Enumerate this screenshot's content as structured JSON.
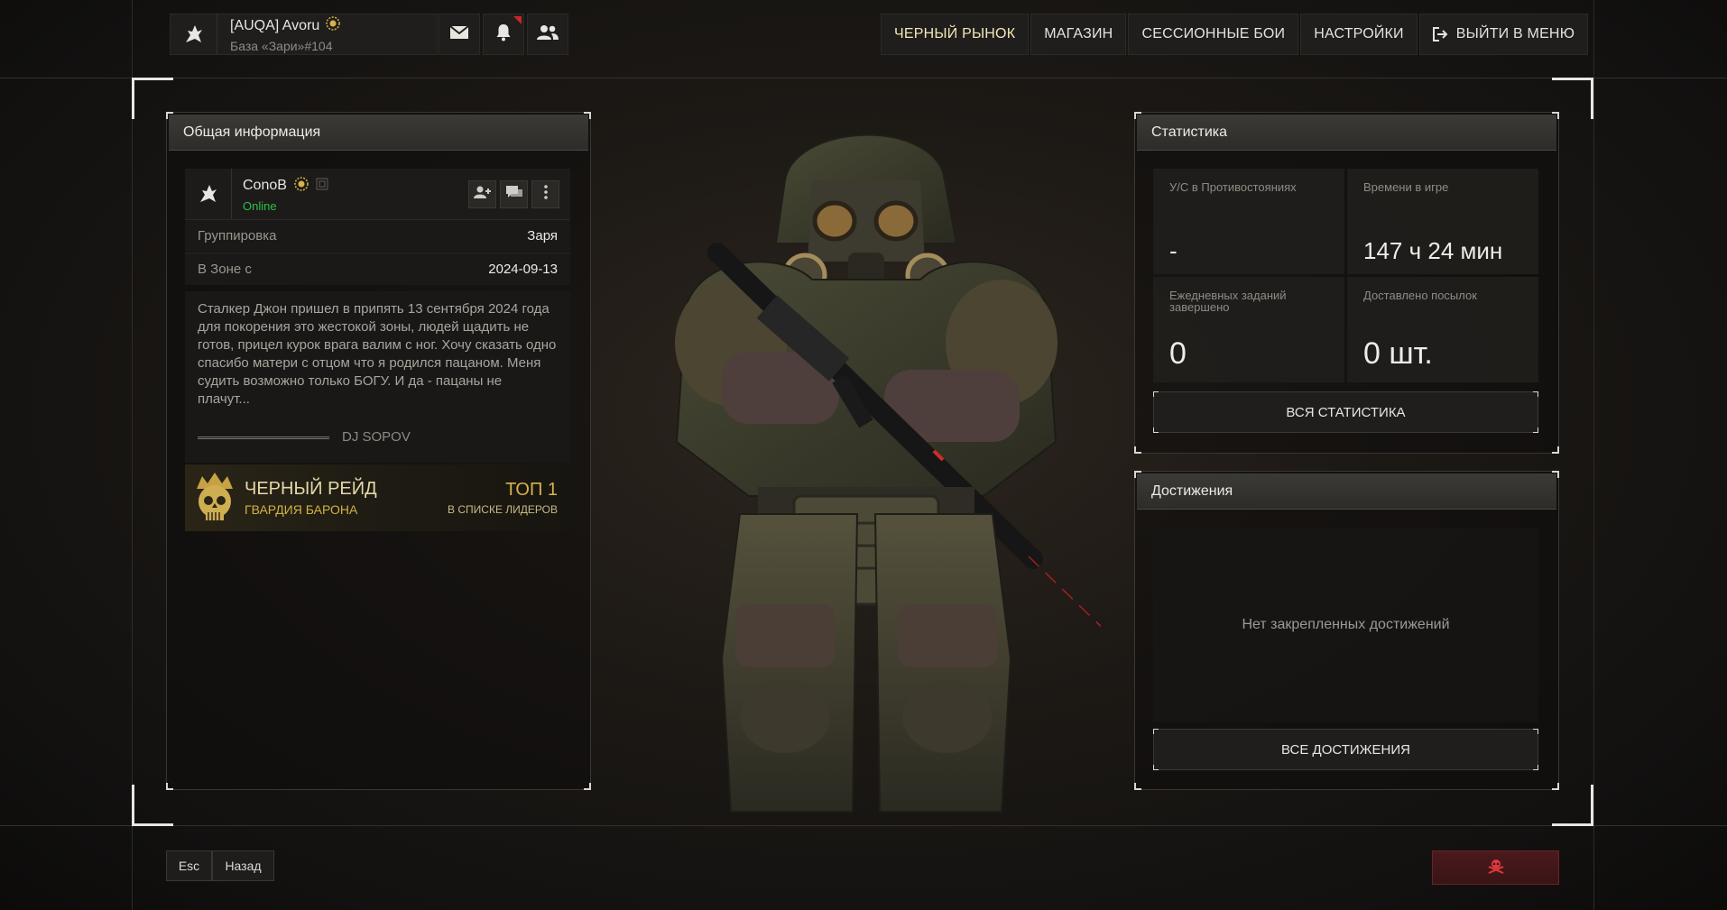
{
  "header": {
    "player_name": "[AUQA] Avoru",
    "base_label": "База «Зари»#104",
    "mail_icon": "mail-icon",
    "notifications_icon": "bell-icon",
    "friends_icon": "friends-icon"
  },
  "topnav": {
    "items": [
      {
        "label": "ЧЕРНЫЙ РЫНОК",
        "active": true
      },
      {
        "label": "МАГАЗИН",
        "active": false
      },
      {
        "label": "СЕССИОННЫЕ БОИ",
        "active": false
      },
      {
        "label": "НАСТРОЙКИ",
        "active": false
      },
      {
        "label": "ВЫЙТИ В МЕНЮ",
        "active": false,
        "icon": "exit-icon"
      }
    ]
  },
  "general_info": {
    "title": "Общая информация",
    "player": {
      "name": "ConoB",
      "status": "Online",
      "actions": [
        "add-friend-icon",
        "chat-icon",
        "more-icon"
      ]
    },
    "rows": [
      {
        "key": "Группировка",
        "value": "Заря"
      },
      {
        "key": "В Зоне с",
        "value": "2024-09-13"
      }
    ],
    "bio": "Сталкер Джон пришел в припять 13 сентября 2024 года для покорения это жестокой зоны, людей щадить не готов, прицел курок врага валим с ног. Хочу сказать одно спасибо матери с отцом что я родился пацаном. Меня судить возможно только БОГУ. И да - пацаны не плачут...",
    "signature": "DJ SOPOV",
    "raid": {
      "title": "ЧЕРНЫЙ РЕЙД",
      "subtitle": "ГВАРДИЯ БАРОНА",
      "rank": "ТОП 1",
      "rank_sub": "В СПИСКЕ ЛИДЕРОВ"
    }
  },
  "statistics": {
    "title": "Статистика",
    "cells": [
      {
        "label": "У/С в Противостояниях",
        "value": "-"
      },
      {
        "label": "Времени в игре",
        "value": "147 ч 24 мин"
      },
      {
        "label": "Ежедневных заданий завершено",
        "value": "0"
      },
      {
        "label": "Доставлено посылок",
        "value": "0 шт."
      }
    ],
    "button": "ВСЯ СТАТИСТИКА"
  },
  "achievements": {
    "title": "Достижения",
    "empty_text": "Нет закрепленных достижений",
    "button": "ВСЕ ДОСТИЖЕНИЯ"
  },
  "footer": {
    "esc_label": "Esc",
    "back_label": "Назад",
    "danger_icon": "skull-crossbones-icon"
  },
  "colors": {
    "accent_gold": "#d8b24a",
    "online_green": "#29c24a",
    "danger_red": "#c8262b"
  }
}
